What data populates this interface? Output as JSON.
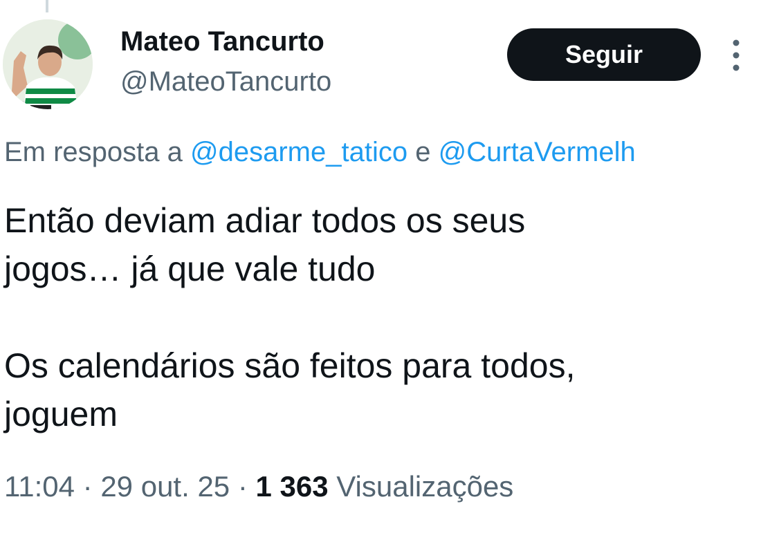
{
  "author": {
    "display_name": "Mateo Tancurto",
    "handle": "@MateoTancurto",
    "avatar_icon": "profile-photo-avatar"
  },
  "actions": {
    "follow_label": "Seguir",
    "more_icon": "more-vertical-icon"
  },
  "reply": {
    "prefix": "Em resposta a ",
    "mention_1": "@desarme_tatico",
    "joiner": " e ",
    "mention_2": "@CurtaVermelh"
  },
  "tweet": {
    "paragraph_1_line_1": "Então deviam adiar todos os seus",
    "paragraph_1_line_2": "jogos… já que vale tudo",
    "paragraph_2_line_1": "Os calendários são feitos para todos,",
    "paragraph_2_line_2": "joguem"
  },
  "meta": {
    "time": "11:04",
    "separator_1": " · ",
    "date": "29 out. 25",
    "separator_2": " · ",
    "views_count": "1 363",
    "views_label": " Visualizações"
  },
  "colors": {
    "text_primary": "#0f1419",
    "text_secondary": "#536471",
    "link": "#1d9bf0",
    "button_bg": "#0f1419",
    "button_text": "#ffffff"
  }
}
